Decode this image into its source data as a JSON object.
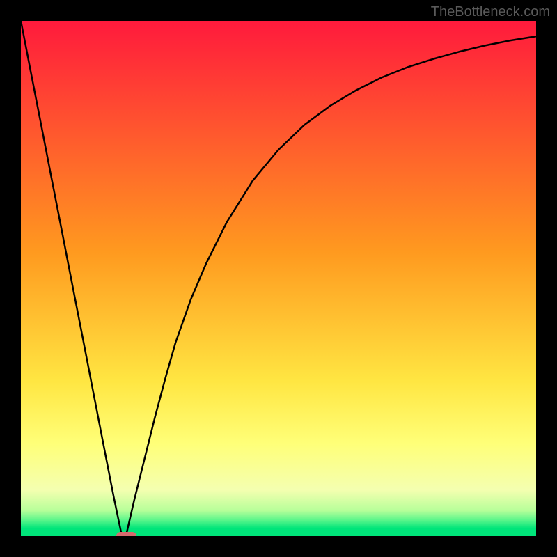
{
  "watermark": {
    "text": "TheBottleneck.com"
  },
  "chart_data": {
    "type": "line",
    "title": "",
    "xlabel": "",
    "ylabel": "",
    "xlim": [
      0,
      100
    ],
    "ylim": [
      0,
      100
    ],
    "gradient_stops": [
      {
        "offset": 0,
        "color": "#ff1a3c"
      },
      {
        "offset": 45,
        "color": "#ff9a1f"
      },
      {
        "offset": 70,
        "color": "#ffe642"
      },
      {
        "offset": 82,
        "color": "#ffff78"
      },
      {
        "offset": 91,
        "color": "#f4ffb0"
      },
      {
        "offset": 95,
        "color": "#b8ff9a"
      },
      {
        "offset": 97,
        "color": "#55f58a"
      },
      {
        "offset": 98.5,
        "color": "#00e57a"
      },
      {
        "offset": 100,
        "color": "#00e57a"
      }
    ],
    "series": [
      {
        "name": "bottleneck-curve",
        "x": [
          0,
          2,
          4,
          6,
          8,
          10,
          12,
          14,
          16,
          18,
          19.5,
          20,
          20.5,
          22,
          24,
          26,
          28,
          30,
          33,
          36,
          40,
          45,
          50,
          55,
          60,
          65,
          70,
          75,
          80,
          85,
          90,
          95,
          100
        ],
        "y": [
          100,
          89.7,
          79.5,
          69.2,
          59.0,
          48.7,
          38.5,
          28.2,
          17.9,
          7.7,
          0.5,
          0,
          0.5,
          7,
          15,
          23,
          30.5,
          37.5,
          46,
          53,
          61,
          69,
          75,
          79.8,
          83.5,
          86.5,
          89,
          91,
          92.6,
          94,
          95.2,
          96.2,
          97
        ]
      }
    ],
    "optimal_marker": {
      "x_start": 18.5,
      "x_end": 22.5,
      "y": 0
    }
  }
}
